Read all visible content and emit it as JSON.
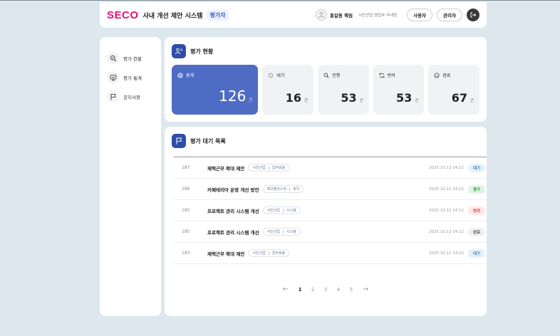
{
  "header": {
    "logo": "SECO",
    "title": "사내 개선 제안 시스템",
    "role": "평가자",
    "user_name": "홍길동 책임",
    "user_dept": "서진산업 영업부 국내팀",
    "btn_user": "사용자",
    "btn_admin": "관리자"
  },
  "sidebar": {
    "items": [
      {
        "label": "평가 현황",
        "icon": "search-list-icon"
      },
      {
        "label": "평가 통계",
        "icon": "chart-monitor-icon"
      },
      {
        "label": "공지사항",
        "icon": "flag-icon"
      }
    ]
  },
  "status": {
    "title": "평가 현황",
    "unit": "건",
    "cards": [
      {
        "label": "총계",
        "value": "126",
        "icon": "globe-icon"
      },
      {
        "label": "대기",
        "value": "16",
        "icon": "loading-icon"
      },
      {
        "label": "진행",
        "value": "53",
        "icon": "search-icon"
      },
      {
        "label": "반려",
        "value": "53",
        "icon": "refresh-icon"
      },
      {
        "label": "완료",
        "value": "67",
        "icon": "smile-icon"
      }
    ]
  },
  "list": {
    "title": "평가 대기 목록",
    "rows": [
      {
        "id": "187",
        "title": "재택근무 확대 제안",
        "tags": [
          "서진산업",
          "업무효율"
        ],
        "date": "2025.10.12 14:12",
        "status": "대기"
      },
      {
        "id": "186",
        "title": "카페테리아 운영 개선 방안",
        "tags": [
          "에코플라스틱",
          "복지"
        ],
        "date": "2025.10.12 14:12",
        "status": "평가"
      },
      {
        "id": "185",
        "title": "프로젝트 관리 시스템 개선",
        "tags": [
          "서진산업",
          "시스템"
        ],
        "date": "2025.10.12 14:12",
        "status": "반려"
      },
      {
        "id": "185",
        "title": "프로젝트 관리 시스템 개선",
        "tags": [
          "서진산업",
          "시스템"
        ],
        "date": "2025.10.12 14:12",
        "status": "완료"
      },
      {
        "id": "183",
        "title": "재택근무 확대 제안",
        "tags": [
          "서진산업",
          "업무효율"
        ],
        "date": "2025.10.12 14:12",
        "status": "대기"
      }
    ]
  },
  "status_colors": {
    "대기": {
      "bg": "#e3f1fc",
      "fg": "#3d7fb8"
    },
    "평가": {
      "bg": "#dff5e3",
      "fg": "#2f9b4b"
    },
    "반려": {
      "bg": "#fde6e6",
      "fg": "#d24545"
    },
    "완료": {
      "bg": "#f0f0f0",
      "fg": "#555555"
    }
  },
  "pagination": {
    "pages": [
      "1",
      "2",
      "3",
      "4",
      "5"
    ],
    "current": "1",
    "prev": "←",
    "next": "→"
  },
  "colors": {
    "brand": "#e3106f",
    "primary": "#4e6cc4",
    "background": "#dde8ee"
  }
}
